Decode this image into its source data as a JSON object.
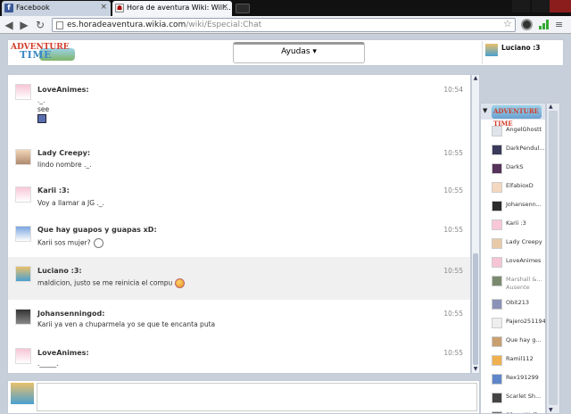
{
  "browser": {
    "tabs": [
      {
        "label": "Facebook",
        "close": "×"
      },
      {
        "label": "Hora de aventura Wiki: Will...",
        "close": "×"
      }
    ],
    "url": {
      "host": "es.horadeaventura.wikia.com",
      "path": "/wiki/Especial:Chat"
    },
    "icons": {
      "back": "back-arrow-icon",
      "forward": "forward-arrow-icon",
      "reload": "reload-icon",
      "star": "star-icon",
      "wrench": "wrench-icon"
    }
  },
  "header": {
    "logo_line1": "ADVENTURE",
    "logo_line2": "TIME",
    "help_label": "Ayudas ▾",
    "current_user": "Luciano :3"
  },
  "messages": [
    {
      "user": "LoveAnimes:",
      "time": "10:54",
      "lines": [
        "._.",
        "see"
      ]
    },
    {
      "user": "Lady Creepy:",
      "time": "10:55",
      "lines": [
        "lindo nombre ._."
      ]
    },
    {
      "user": "Karii :3:",
      "time": "10:55",
      "lines": [
        "Voy a llamar a JG ._."
      ]
    },
    {
      "user": "Que hay guapos y guapas xD:",
      "time": "10:55",
      "lines": [
        "Karii sos mujer?"
      ]
    },
    {
      "user": "Luciano :3:",
      "time": "10:55",
      "lines": [
        "maldicion, justo se me reinicia el compu"
      ]
    },
    {
      "user": "Johansenningod:",
      "time": "10:55",
      "lines": [
        "Karii ya ven a chuparmela yo se que te encanta puta"
      ]
    },
    {
      "user": "LoveAnimes:",
      "time": "10:55",
      "lines": [
        "._____."
      ]
    }
  ],
  "sidebar": {
    "room_logo": "ADVENTURE TIME",
    "users": [
      {
        "name": "AngelGhostt"
      },
      {
        "name": "DarkPendul..."
      },
      {
        "name": "DarkS"
      },
      {
        "name": "ElfabioxD"
      },
      {
        "name": "Johansenn..."
      },
      {
        "name": "Karii :3"
      },
      {
        "name": "Lady Creepy"
      },
      {
        "name": "LoveAnimes"
      },
      {
        "name": "Marshall &...",
        "status": "Ausente"
      },
      {
        "name": "Obit213"
      },
      {
        "name": "Pajero251194"
      },
      {
        "name": "Que hay g..."
      },
      {
        "name": "Ramil112"
      },
      {
        "name": "Rex191299"
      },
      {
        "name": "Scarlet Sh..."
      },
      {
        "name": "Silver Wolf..."
      }
    ]
  },
  "colors": {
    "accent": "#c7cfda",
    "highlight_row": "#f0f0f0",
    "tab_active": "#f3f5f9"
  }
}
